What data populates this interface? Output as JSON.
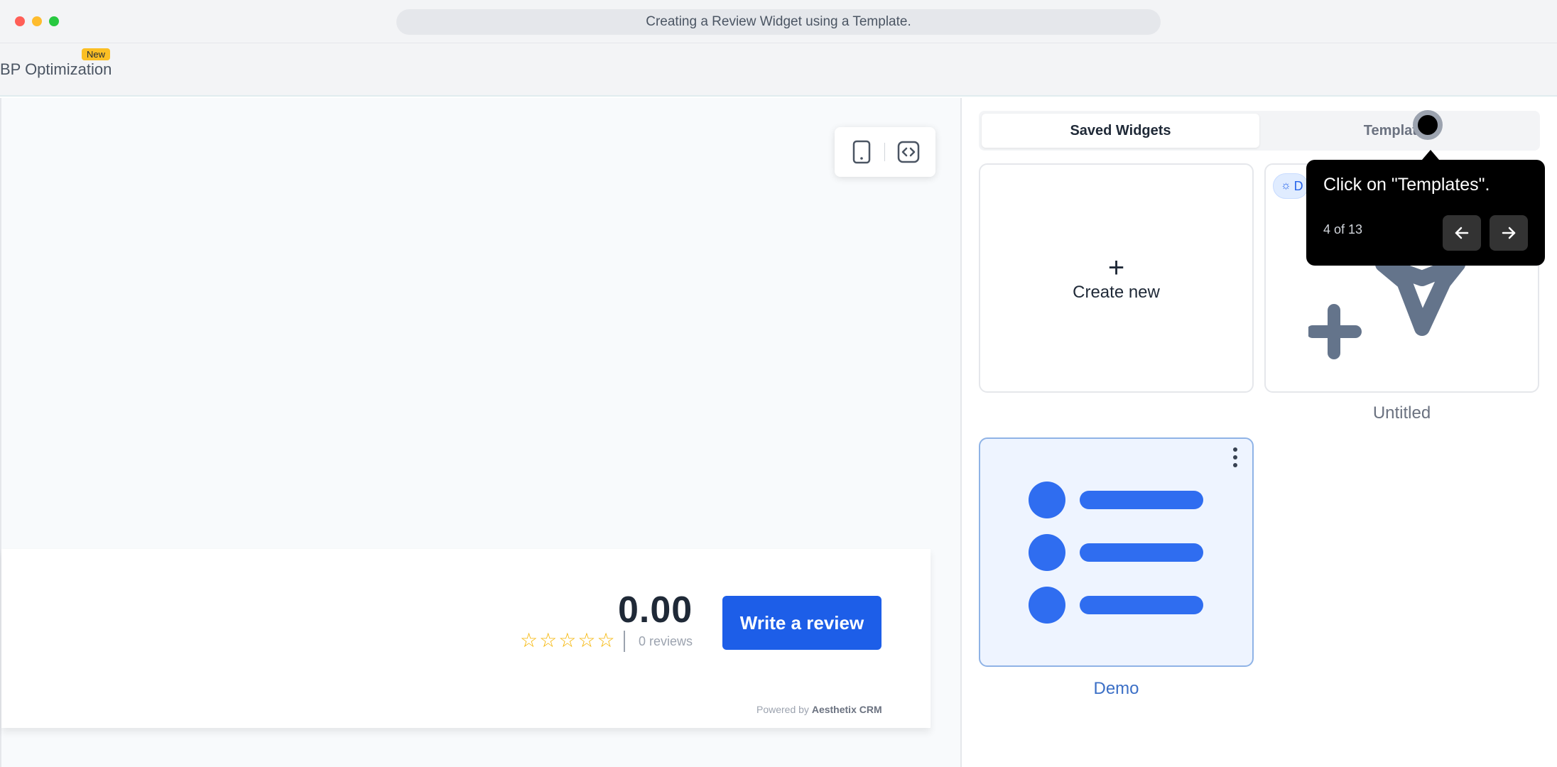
{
  "window": {
    "address": "Creating a Review Widget using a Template."
  },
  "header": {
    "nav_label": "BP Optimization",
    "new_badge": "New"
  },
  "preview": {
    "toolbar": {
      "mobile_icon": "mobile-phone-icon",
      "embed_icon": "code-embed-icon"
    },
    "review": {
      "score": "0.00",
      "stars": 5,
      "count": "0 reviews",
      "write_button": "Write a review",
      "powered_prefix": "Powered by",
      "powered_brand": "Aesthetix CRM"
    }
  },
  "sidebar": {
    "tabs": [
      {
        "label": "Saved Widgets",
        "active": true
      },
      {
        "label": "Templates",
        "active": false
      }
    ],
    "create_new": "Create new",
    "cards": [
      {
        "label": "Untitled",
        "chip": "D"
      },
      {
        "label": "Demo"
      }
    ]
  },
  "tooltip": {
    "text": "Click on \"Templates\".",
    "step": "4 of 13"
  },
  "colors": {
    "primary": "#1d5ee8",
    "star": "#f5b400",
    "demo_accent": "#2f6df0"
  }
}
